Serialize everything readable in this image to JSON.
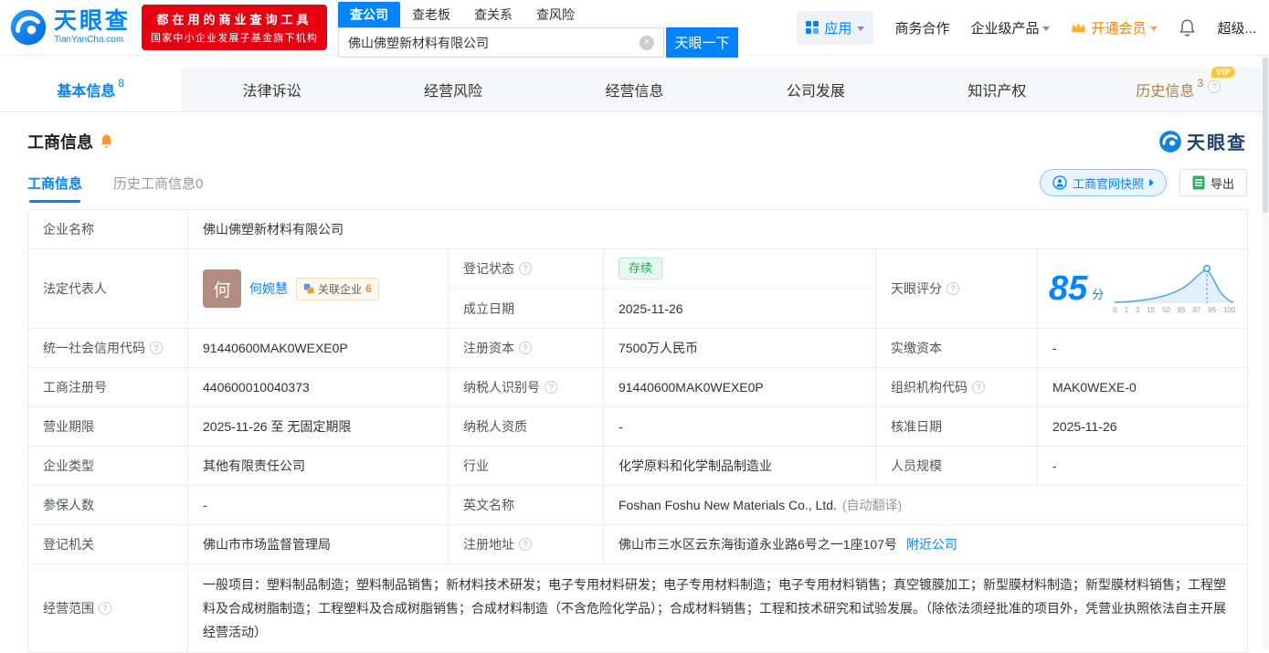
{
  "colors": {
    "brand_blue": "#0084ff",
    "promo_red": "#e60012",
    "vip_orange": "#ff8000",
    "status_green": "#27a35d",
    "history_gold": "#ab8143"
  },
  "header": {
    "logo_title": "天眼查",
    "logo_subtitle": "TianYanCha.com",
    "promo_line1": "都在用的商业查询工具",
    "promo_line2": "国家中小企业发展子基金旗下机构",
    "search_tabs": [
      {
        "label": "查公司"
      },
      {
        "label": "查老板"
      },
      {
        "label": "查关系"
      },
      {
        "label": "查风险"
      }
    ],
    "search_value": "佛山佛塑新材料有限公司",
    "search_button": "天眼一下",
    "menu": {
      "apps": "应用",
      "cooperation": "商务合作",
      "enterprise": "企业级产品",
      "vip": "开通会员",
      "super": "超级..."
    }
  },
  "nav_tabs": [
    {
      "label": "基本信息",
      "count": "8"
    },
    {
      "label": "法律诉讼"
    },
    {
      "label": "经营风险"
    },
    {
      "label": "经营信息"
    },
    {
      "label": "公司发展"
    },
    {
      "label": "知识产权"
    },
    {
      "label": "历史信息",
      "count": "3",
      "vip": "VIP"
    }
  ],
  "section": {
    "title": "工商信息",
    "brand": "天眼查",
    "subtabs": [
      {
        "label": "工商信息"
      },
      {
        "label": "历史工商信息0"
      }
    ],
    "snapshot_button": "工商官网快照",
    "export_button": "导出"
  },
  "table": {
    "company_name": {
      "label": "企业名称",
      "value": "佛山佛塑新材料有限公司"
    },
    "legal_rep": {
      "label": "法定代表人",
      "avatar_char": "何",
      "name": "何婉慧",
      "related_label": "关联企业",
      "related_count": "6"
    },
    "reg_status": {
      "label": "登记状态",
      "value": "存续"
    },
    "establish_date": {
      "label": "成立日期",
      "value": "2025-11-26"
    },
    "score": {
      "label": "天眼评分",
      "value": "85",
      "unit": "分",
      "axis": [
        "0",
        "1",
        "3",
        "15",
        "50",
        "85",
        "97",
        "99",
        "100"
      ]
    },
    "credit_code": {
      "label": "统一社会信用代码",
      "value": "91440600MAK0WEXE0P"
    },
    "reg_capital": {
      "label": "注册资本",
      "value": "7500万人民币"
    },
    "paid_capital": {
      "label": "实缴资本",
      "value": "-"
    },
    "reg_number": {
      "label": "工商注册号",
      "value": "440600010040373"
    },
    "taxpayer_id": {
      "label": "纳税人识别号",
      "value": "91440600MAK0WEXE0P"
    },
    "org_code": {
      "label": "组织机构代码",
      "value": "MAK0WEXE-0"
    },
    "business_term": {
      "label": "营业期限",
      "value": "2025-11-26 至 无固定期限"
    },
    "taxpayer_quality": {
      "label": "纳税人资质",
      "value": "-"
    },
    "approval_date": {
      "label": "核准日期",
      "value": "2025-11-26"
    },
    "company_type": {
      "label": "企业类型",
      "value": "其他有限责任公司"
    },
    "industry": {
      "label": "行业",
      "value": "化学原料和化学制品制造业"
    },
    "staff_size": {
      "label": "人员规模",
      "value": "-"
    },
    "insured_count": {
      "label": "参保人数",
      "value": "-"
    },
    "english_name": {
      "label": "英文名称",
      "value": "Foshan Foshu New Materials Co., Ltd.",
      "note": "(自动翻译)"
    },
    "reg_authority": {
      "label": "登记机关",
      "value": "佛山市市场监督管理局"
    },
    "reg_address": {
      "label": "注册地址",
      "value": "佛山市三水区云东海街道永业路6号之一1座107号",
      "link": "附近公司"
    },
    "business_scope": {
      "label": "经营范围",
      "value": "一般项目：塑料制品制造；塑料制品销售；新材料技术研发；电子专用材料研发；电子专用材料制造；电子专用材料销售；真空镀膜加工；新型膜材料制造；新型膜材料销售；工程塑料及合成树脂制造；工程塑料及合成树脂销售；合成材料制造（不含危险化学品）；合成材料销售；工程和技术研究和试验发展。（除依法须经批准的项目外，凭营业执照依法自主开展经营活动）"
    }
  }
}
